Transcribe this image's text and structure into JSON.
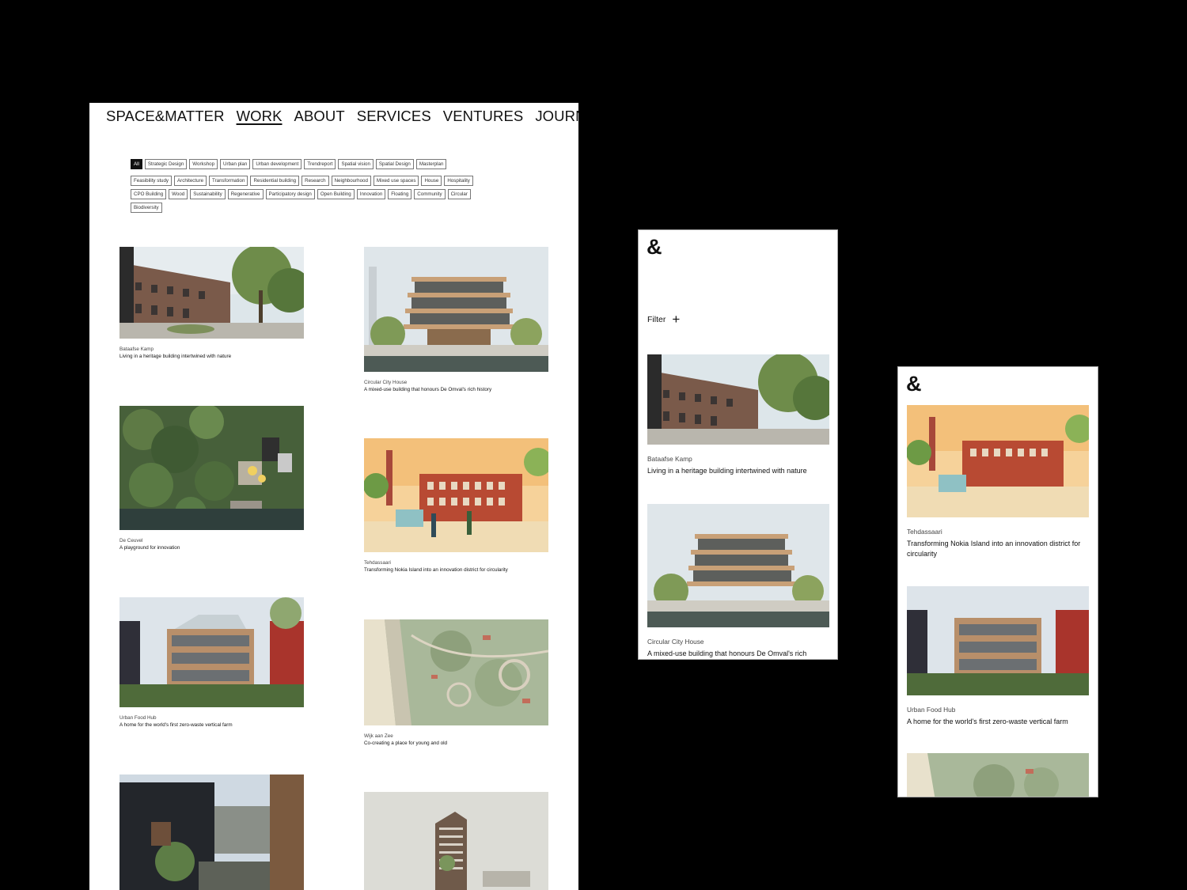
{
  "desktop": {
    "nav": [
      "SPACE&MATTER",
      "WORK",
      "ABOUT",
      "SERVICES",
      "VENTURES",
      "JOURNAL"
    ],
    "nav_active": "WORK",
    "filter_rows": [
      [
        "All",
        "Strategic Design",
        "Workshop",
        "Urban plan",
        "Urban development",
        "Trendreport",
        "Spatial vision",
        "Spatial Design",
        "Masterplan"
      ],
      [
        "Feasibility study",
        "Architecture",
        "Transformation",
        "Residential building",
        "Research",
        "Neighbourhood",
        "Mixed use spaces",
        "House",
        "Hospitality"
      ],
      [
        "CPO Building",
        "Wood",
        "Sustainability",
        "Regenerative",
        "Participatory design",
        "Open Building",
        "Innovation",
        "Floating",
        "Community",
        "Circular"
      ],
      [
        "Biodiversity"
      ]
    ],
    "filter_active": "All",
    "projects": [
      {
        "title": "Bataafse Kamp",
        "desc": "Living in a heritage building intertwined with nature"
      },
      {
        "title": "Circular City House",
        "desc": "A mixed-use building that honours De Omval's rich history"
      },
      {
        "title": "De Ceuvel",
        "desc": "A playground for innovation"
      },
      {
        "title": "Tehdassaari",
        "desc": "Transforming Nokia Island into an innovation district for circularity"
      },
      {
        "title": "Urban Food Hub",
        "desc": "A home for the world's first zero-waste vertical farm"
      },
      {
        "title": "Wijk aan Zee",
        "desc": "Co-creating a place for young and old"
      }
    ]
  },
  "mobile1": {
    "logo": "&",
    "filter_label": "Filter",
    "filter_icon": "+",
    "projects": [
      {
        "title": "Bataafse Kamp",
        "desc": "Living in a heritage building intertwined with nature"
      },
      {
        "title": "Circular City House",
        "desc": "A mixed-use building that honours De Omval's rich history"
      }
    ]
  },
  "mobile2": {
    "logo": "&",
    "projects": [
      {
        "title": "Tehdassaari",
        "desc": "Transforming Nokia Island into an innovation district for circularity"
      },
      {
        "title": "Urban Food Hub",
        "desc": "A home for the world's first zero-waste vertical farm"
      }
    ]
  }
}
